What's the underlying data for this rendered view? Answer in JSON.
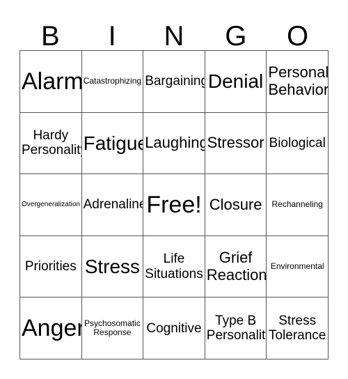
{
  "card": {
    "title": "BINGO",
    "header_letters": [
      "B",
      "I",
      "N",
      "G",
      "O"
    ],
    "rows": [
      [
        {
          "text": "Alarm",
          "size": "xxl"
        },
        {
          "text": "Catastrophizing",
          "size": "xs"
        },
        {
          "text": "Bargaining",
          "size": "md"
        },
        {
          "text": "Denial",
          "size": "xl"
        },
        {
          "text": "Personal\nBehavior",
          "size": "lg"
        }
      ],
      [
        {
          "text": "Hardy\nPersonality",
          "size": "md"
        },
        {
          "text": "Fatigue",
          "size": "xl"
        },
        {
          "text": "Laughing",
          "size": "lg"
        },
        {
          "text": "Stressor",
          "size": "lg"
        },
        {
          "text": "Biological",
          "size": "md"
        }
      ],
      [
        {
          "text": "Overgeneralization",
          "size": "xxs"
        },
        {
          "text": "Adrenaline",
          "size": "md"
        },
        {
          "text": "Free!",
          "size": "xxl"
        },
        {
          "text": "Closure",
          "size": "lg"
        },
        {
          "text": "Rechanneling",
          "size": "xs"
        }
      ],
      [
        {
          "text": "Priorities",
          "size": "md"
        },
        {
          "text": "Stress",
          "size": "xl"
        },
        {
          "text": "Life\nSituations",
          "size": "md"
        },
        {
          "text": "Grief\nReaction",
          "size": "lg"
        },
        {
          "text": "Environmental",
          "size": "xs"
        }
      ],
      [
        {
          "text": "Anger",
          "size": "xxl"
        },
        {
          "text": "Psychosomatic\nResponse",
          "size": "xs"
        },
        {
          "text": "Cognitive",
          "size": "md"
        },
        {
          "text": "Type B\nPersonality",
          "size": "md"
        },
        {
          "text": "Stress\nTolerance",
          "size": "md"
        }
      ]
    ],
    "colors": {
      "background": "#ffffff",
      "text": "#000000",
      "grid_line": "#555555"
    }
  }
}
